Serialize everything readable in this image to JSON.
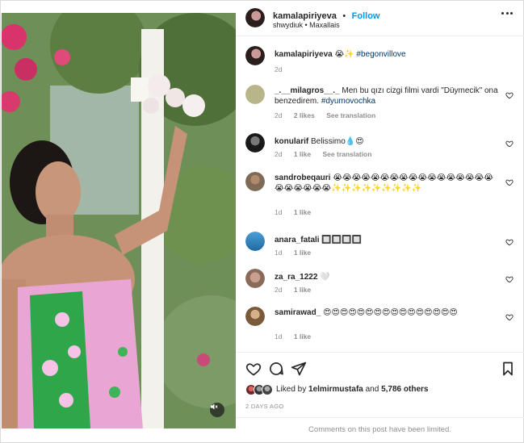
{
  "header": {
    "username": "kamalapiriyeva",
    "separator": "•",
    "follow_label": "Follow",
    "location": "shwydiuk • Maxallais"
  },
  "caption": {
    "username": "kamalapiriyeva",
    "text": "😭✨",
    "hashtag": "#begonvillove",
    "time": "2d"
  },
  "comments": [
    {
      "username": "_.__milagros__._",
      "text": "Men bu qızı cizgi filmi vardi \"Düymecik\" ona benzedirem.",
      "hashtag": "#dyumovochka",
      "time": "2d",
      "likes": "2 likes",
      "translate": "See translation"
    },
    {
      "username": "konularif",
      "text": "Belissimo💧😍",
      "hashtag": "",
      "time": "2d",
      "likes": "1 like",
      "translate": "See translation"
    },
    {
      "username": "sandrobeqauri",
      "text": "😭😭😭😭😭😭😭😭😭😭😭😭😭😭😭😭😭😭😭😭😭😭😭✨✨✨✨✨✨✨✨✨",
      "hashtag": "",
      "time": "1d",
      "likes": "1 like",
      "translate": ""
    },
    {
      "username": "anara_fatali",
      "text": "🔲🔲🔲🔲",
      "hashtag": "",
      "time": "1d",
      "likes": "1 like",
      "translate": ""
    },
    {
      "username": "za_ra_1222",
      "text": "🤍",
      "hashtag": "",
      "time": "2d",
      "likes": "1 like",
      "translate": ""
    },
    {
      "username": "samirawad_",
      "text": "😍😍😍😍😍😍😍😍😍😍😍😍😍😍😍😍",
      "hashtag": "",
      "time": "1d",
      "likes": "1 like",
      "translate": ""
    }
  ],
  "likes": {
    "prefix": "Liked by",
    "user": "1elmirmustafa",
    "middle": "and",
    "count": "5,786 others"
  },
  "posted": "2 DAYS AGO",
  "limited_note": "Comments on this post have been limited."
}
